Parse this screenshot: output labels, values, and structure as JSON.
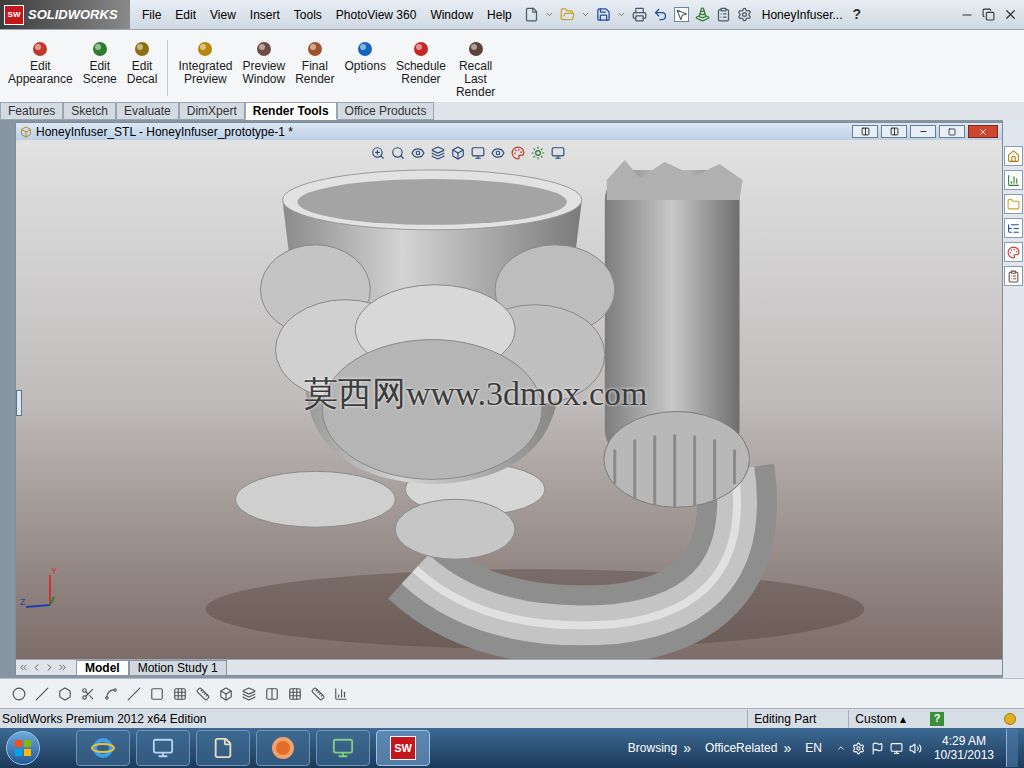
{
  "app": {
    "logo_icon": "SW",
    "logo": "SOLIDWORKS"
  },
  "menu": [
    "File",
    "Edit",
    "View",
    "Insert",
    "Tools",
    "PhotoView 360",
    "Window",
    "Help"
  ],
  "window": {
    "title": "HoneyInfuser...",
    "help": "?"
  },
  "command_buttons": [
    {
      "lines": [
        "Edit",
        "Appearance"
      ]
    },
    {
      "lines": [
        "Edit",
        "Scene"
      ]
    },
    {
      "lines": [
        "Edit",
        "Decal"
      ]
    },
    {
      "lines": [
        "Integrated",
        "Preview"
      ]
    },
    {
      "lines": [
        "Preview",
        "Window"
      ]
    },
    {
      "lines": [
        "Final",
        "Render"
      ]
    },
    {
      "lines": [
        "Options"
      ]
    },
    {
      "lines": [
        "Schedule",
        "Render"
      ]
    },
    {
      "lines": [
        "Recall",
        "Last",
        "Render"
      ]
    }
  ],
  "tabs": [
    {
      "label": "Features",
      "selected": false
    },
    {
      "label": "Sketch",
      "selected": false
    },
    {
      "label": "Evaluate",
      "selected": false
    },
    {
      "label": "DimXpert",
      "selected": false
    },
    {
      "label": "Render Tools",
      "selected": true
    },
    {
      "label": "Office Products",
      "selected": false
    }
  ],
  "document": {
    "title": "HoneyInfuser_STL - HoneyInfuser_prototype-1 *",
    "watermark": "莫西网www.3dmox.com",
    "triad": [
      "Y",
      "Z"
    ]
  },
  "model_tabs": [
    {
      "label": "Model",
      "selected": true
    },
    {
      "label": "Motion Study 1",
      "selected": false
    }
  ],
  "status_bar": {
    "edition": "SolidWorks Premium 2012 x64 Edition",
    "mode": "Editing Part",
    "units": "Custom",
    "units_arrow": "▴",
    "help": "?"
  },
  "taskbar": {
    "sw_icon": "SW",
    "toolbars": [
      {
        "label": "Browsing",
        "chevron": "»"
      },
      {
        "label": "OfficeRelated",
        "chevron": "»"
      }
    ],
    "language": "EN",
    "time": "4:29 AM",
    "date": "10/31/2013"
  }
}
